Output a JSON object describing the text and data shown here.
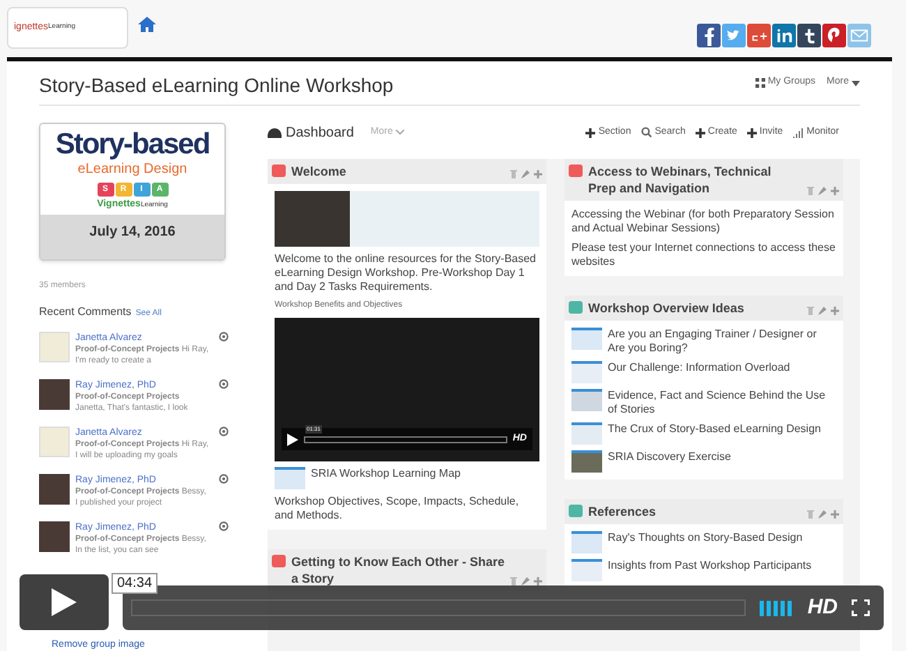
{
  "site_header": {
    "logo": {
      "part_1": "ignettes",
      "part_2": "Learning"
    },
    "share_icons": [
      {
        "kind": "facebook",
        "color": "#3b5998"
      },
      {
        "kind": "twitter",
        "color": "#55acee"
      },
      {
        "kind": "google",
        "color": "#dd4b39"
      },
      {
        "kind": "linkedin",
        "color": "#0e76a8"
      },
      {
        "kind": "tumblr",
        "color": "#35465c"
      },
      {
        "kind": "pinterest",
        "color": "#cb2027"
      },
      {
        "kind": "email",
        "color": "#8fc3e8"
      }
    ]
  },
  "group": {
    "title": "Story-Based eLearning Online Workshop",
    "links": [
      {
        "label": "My Groups",
        "kind": "grid"
      },
      {
        "label": "More",
        "kind": "caret"
      }
    ]
  },
  "banner": {
    "title": "Story-based",
    "subtitle": "eLearning Design",
    "letters": [
      {
        "text": "S",
        "color": "#e5435a"
      },
      {
        "text": "R",
        "color": "#f2b632"
      },
      {
        "text": "I",
        "color": "#3fa4d8"
      },
      {
        "text": "A",
        "color": "#5db56a"
      }
    ],
    "brand": {
      "part_1": "Vignettes",
      "part_2": "Learning"
    },
    "date": "July 14, 2016"
  },
  "members": "35 members",
  "recent_comments": {
    "title": "Recent Comments",
    "link": "See All",
    "items": [
      {
        "kind": "cartoon",
        "name": "Janetta Alvarez",
        "text": "**Proof-of-Concept Projects** Hi Ray, I'm ready to create a"
      },
      {
        "kind": "photo",
        "name": "Ray Jimenez, PhD",
        "text": "**Proof-of-Concept Projects** Janetta, That's fantastic, I look"
      },
      {
        "kind": "cartoon",
        "name": "Janetta Alvarez",
        "text": "**Proof-of-Concept Projects** Hi Ray, I will be uploading my goals"
      },
      {
        "kind": "photo",
        "name": "Ray Jimenez, PhD",
        "text": "**Proof-of-Concept Projects** Bessy, I published your project"
      },
      {
        "kind": "photo",
        "name": "Ray Jimenez, PhD",
        "text": "**Proof-of-Concept Projects** Bessy, In the list, you can see"
      }
    ],
    "footer_link": "Remove group image"
  },
  "dashboard": {
    "title": "Dashboard",
    "more": "More",
    "actions": [
      {
        "label": "Section",
        "kind": "plus"
      },
      {
        "label": "Search",
        "kind": "search"
      },
      {
        "label": "Create",
        "kind": "plus"
      },
      {
        "label": "Invite",
        "kind": "plus"
      },
      {
        "label": "Monitor",
        "kind": "bars"
      }
    ]
  },
  "columns": [
    [
      {
        "title": "Welcome",
        "color": "#ef5a5a",
        "blocks": [
          {
            "kind": "photo"
          },
          {
            "kind": "paragraph",
            "text": "Welcome to the online resources for the Story-Based eLearning Design Workshop. Pre-Workshop Day 1 and Day 2 Tasks Requirements."
          },
          {
            "kind": "caption",
            "text": "Workshop Benefits and Objectives"
          },
          {
            "kind": "video",
            "time": "01:31",
            "quality": "HD"
          },
          {
            "kind": "link",
            "text": "SRIA Workshop Learning Map"
          },
          {
            "kind": "paragraph",
            "text": "Workshop Objectives, Scope, Impacts, Schedule, and Methods."
          }
        ]
      },
      {
        "title": "Getting to Know Each Other - Share a Story",
        "color": "#ef5a5a"
      }
    ],
    [
      {
        "title": "Access to Webinars, Technical Prep and Navigation",
        "color": "#ef5a5a",
        "blocks": [
          {
            "kind": "paragraph",
            "text": "Accessing the Webinar (for both Preparatory Session and Actual Webinar Sessions)"
          },
          {
            "kind": "paragraph",
            "text": "Please test your Internet connections to access these websites"
          }
        ]
      },
      {
        "title": "Workshop Overview Ideas",
        "color": "#4db6a4",
        "blocks": [
          {
            "kind": "link",
            "text": "Are you an Engaging Trainer / Designer or Are you Boring?"
          },
          {
            "kind": "link",
            "text": "Our Challenge: Information Overload"
          },
          {
            "kind": "link",
            "text": "Evidence, Fact and Science Behind the Use of Stories"
          },
          {
            "kind": "link",
            "text": "The Crux of Story-Based eLearning Design"
          },
          {
            "kind": "link",
            "text": "SRIA Discovery Exercise"
          }
        ]
      },
      {
        "title": "References",
        "color": "#4db6a4",
        "blocks": [
          {
            "kind": "link",
            "text": "Ray's Thoughts on Story-Based Design"
          },
          {
            "kind": "link",
            "text": "Insights from Past Workshop Participants"
          }
        ]
      }
    ]
  ],
  "player": {
    "hover_time": "04:34",
    "quality": "HD"
  }
}
